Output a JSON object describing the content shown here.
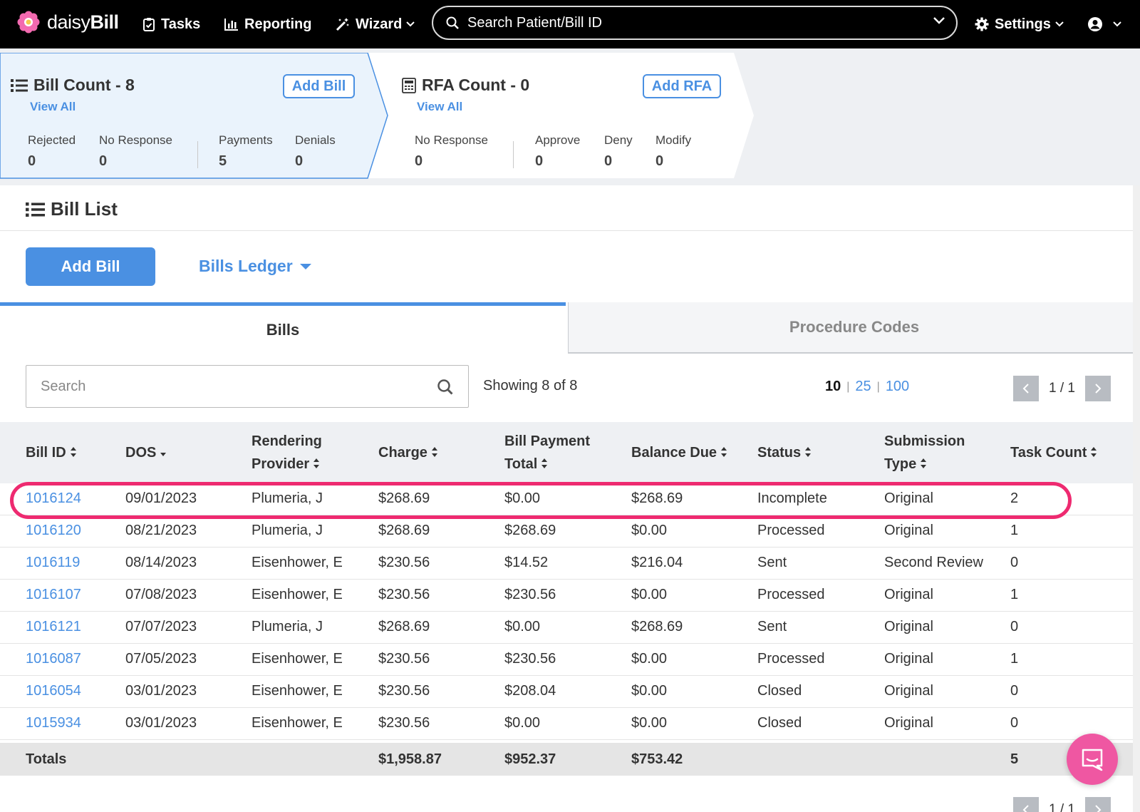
{
  "nav": {
    "brand_light": "daisy",
    "brand_bold": "Bill",
    "tasks": "Tasks",
    "reporting": "Reporting",
    "wizard": "Wizard",
    "search_placeholder": "Search Patient/Bill ID",
    "settings": "Settings"
  },
  "bill_card": {
    "title": "Bill Count - 8",
    "view_all": "View All",
    "add_button": "Add Bill",
    "stats": [
      {
        "label": "Rejected",
        "value": "0"
      },
      {
        "label": "No Response",
        "value": "0"
      },
      {
        "label": "Payments",
        "value": "5"
      },
      {
        "label": "Denials",
        "value": "0"
      }
    ]
  },
  "rfa_card": {
    "title": "RFA Count - 0",
    "view_all": "View All",
    "add_button": "Add RFA",
    "stats": [
      {
        "label": "No Response",
        "value": "0"
      },
      {
        "label": "Approve",
        "value": "0"
      },
      {
        "label": "Deny",
        "value": "0"
      },
      {
        "label": "Modify",
        "value": "0"
      }
    ]
  },
  "bill_list": {
    "title": "Bill List",
    "add_bill": "Add Bill",
    "ledger": "Bills Ledger",
    "tabs": [
      "Bills",
      "Procedure Codes"
    ],
    "search_placeholder": "Search",
    "showing": "Showing 8 of 8",
    "per_page": [
      "10",
      "25",
      "100"
    ],
    "page": "1 / 1"
  },
  "table": {
    "headers": {
      "bill_id": "Bill ID",
      "dos": "DOS",
      "provider_1": "Rendering",
      "provider_2": "Provider",
      "charge": "Charge",
      "payment_1": "Bill Payment",
      "payment_2": "Total",
      "balance": "Balance Due",
      "status": "Status",
      "sub_1": "Submission",
      "sub_2": "Type",
      "task_count": "Task Count"
    },
    "rows": [
      {
        "id": "1016124",
        "dos": "09/01/2023",
        "provider": "Plumeria, J",
        "charge": "$268.69",
        "payment": "$0.00",
        "balance": "$268.69",
        "status": "Incomplete",
        "type": "Original",
        "tasks": "2"
      },
      {
        "id": "1016120",
        "dos": "08/21/2023",
        "provider": "Plumeria, J",
        "charge": "$268.69",
        "payment": "$268.69",
        "balance": "$0.00",
        "status": "Processed",
        "type": "Original",
        "tasks": "1"
      },
      {
        "id": "1016119",
        "dos": "08/14/2023",
        "provider": "Eisenhower, E",
        "charge": "$230.56",
        "payment": "$14.52",
        "balance": "$216.04",
        "status": "Sent",
        "type": "Second Review",
        "tasks": "0"
      },
      {
        "id": "1016107",
        "dos": "07/08/2023",
        "provider": "Eisenhower, E",
        "charge": "$230.56",
        "payment": "$230.56",
        "balance": "$0.00",
        "status": "Processed",
        "type": "Original",
        "tasks": "1"
      },
      {
        "id": "1016121",
        "dos": "07/07/2023",
        "provider": "Plumeria, J",
        "charge": "$268.69",
        "payment": "$0.00",
        "balance": "$268.69",
        "status": "Sent",
        "type": "Original",
        "tasks": "0"
      },
      {
        "id": "1016087",
        "dos": "07/05/2023",
        "provider": "Eisenhower, E",
        "charge": "$230.56",
        "payment": "$230.56",
        "balance": "$0.00",
        "status": "Processed",
        "type": "Original",
        "tasks": "1"
      },
      {
        "id": "1016054",
        "dos": "03/01/2023",
        "provider": "Eisenhower, E",
        "charge": "$230.56",
        "payment": "$208.04",
        "balance": "$0.00",
        "status": "Closed",
        "type": "Original",
        "tasks": "0"
      },
      {
        "id": "1015934",
        "dos": "03/01/2023",
        "provider": "Eisenhower, E",
        "charge": "$230.56",
        "payment": "$0.00",
        "balance": "$0.00",
        "status": "Closed",
        "type": "Original",
        "tasks": "0"
      }
    ],
    "totals": {
      "label": "Totals",
      "charge": "$1,958.87",
      "payment": "$952.37",
      "balance": "$753.42",
      "tasks": "5"
    }
  },
  "colors": {
    "accent": "#4a90e2",
    "highlight": "#ee2a70",
    "chat": "#ef57a2"
  }
}
